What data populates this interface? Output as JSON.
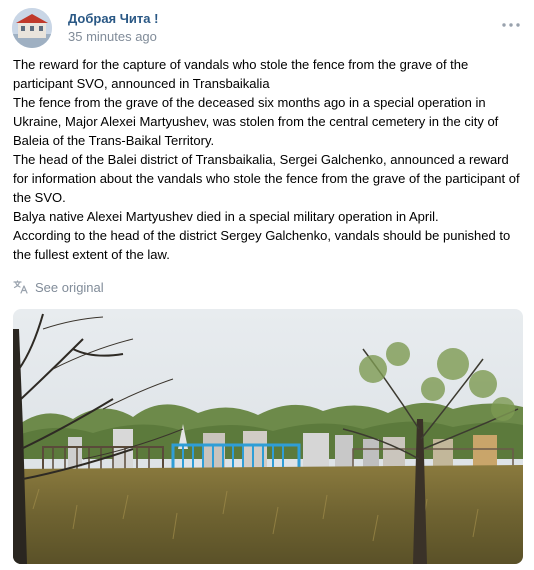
{
  "post": {
    "author": "Добрая Чита !",
    "time": "35 minutes ago",
    "paragraphs": [
      "The reward for the capture of vandals who stole the fence from the grave of the participant SVO, announced in Transbaikalia",
      "The fence from the grave of the deceased six months ago in a special operation in Ukraine, Major Alexei Martyushev, was stolen from the central cemetery in the city of Baleia of the Trans-Baikal Territory.",
      "The head of the Balei district of Transbaikalia, Sergei Galchenko, announced a reward for information about the vandals who stole the fence from the grave of the participant of the SVO.",
      "Balya native Alexei Martyushev died in a special military operation in April.",
      "According to the head of the district Sergey Galchenko, vandals should be punished to the fullest extent of the law."
    ],
    "see_original": "See original",
    "icons": {
      "avatar": "avatar-image",
      "more": "more-dots-icon",
      "translate": "translate-icon"
    },
    "colors": {
      "author": "#2a5885",
      "muted": "#818c99"
    }
  }
}
